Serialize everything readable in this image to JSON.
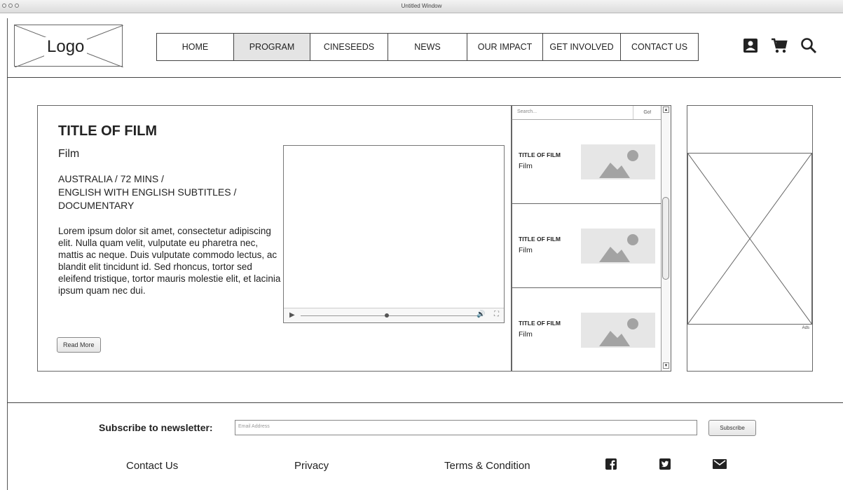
{
  "window": {
    "title": "Untitled Window"
  },
  "logo": {
    "text": "Logo"
  },
  "nav": [
    {
      "label": "HOME",
      "active": false
    },
    {
      "label": "PROGRAM",
      "active": true
    },
    {
      "label": "CINESEEDS",
      "active": false
    },
    {
      "label": "NEWS",
      "active": false
    },
    {
      "label": "OUR IMPACT",
      "active": false
    },
    {
      "label": "GET INVOLVED",
      "active": false
    },
    {
      "label": "CONTACT US",
      "active": false
    }
  ],
  "header_icons": [
    "account-icon",
    "cart-icon",
    "search-icon"
  ],
  "film": {
    "title": "TITLE OF FILM",
    "subtitle": "Film",
    "meta_line1": "AUSTRALIA / 72 MINS /",
    "meta_line2": "ENGLISH WITH ENGLISH SUBTITLES /",
    "meta_line3": "DOCUMENTARY",
    "description": "Lorem ipsum dolor sit amet, consectetur adipiscing elit. Nulla quam velit, vulputate eu pharetra nec, mattis ac neque. Duis vulputate commodo lectus, ac blandit elit tincidunt id. Sed rhoncus, tortor sed eleifend tristique, tortor mauris molestie elit, et lacinia ipsum quam nec dui.",
    "read_more": "Read More"
  },
  "sidebar": {
    "search_placeholder": "Search...",
    "search_go": "Go!",
    "items": [
      {
        "title": "TITLE OF FILM",
        "subtitle": "Film"
      },
      {
        "title": "TITLE OF FILM",
        "subtitle": "Film"
      },
      {
        "title": "TITLE OF FILM",
        "subtitle": "Film"
      }
    ]
  },
  "ad": {
    "label": "Ads"
  },
  "footer": {
    "newsletter_label": "Subscribe to newsletter:",
    "email_placeholder": "Email Address",
    "subscribe_button": "Subscribe",
    "links": [
      "Contact Us",
      "Privacy",
      "Terms & Condition"
    ],
    "social": [
      "facebook-icon",
      "twitter-icon",
      "mail-icon"
    ]
  }
}
